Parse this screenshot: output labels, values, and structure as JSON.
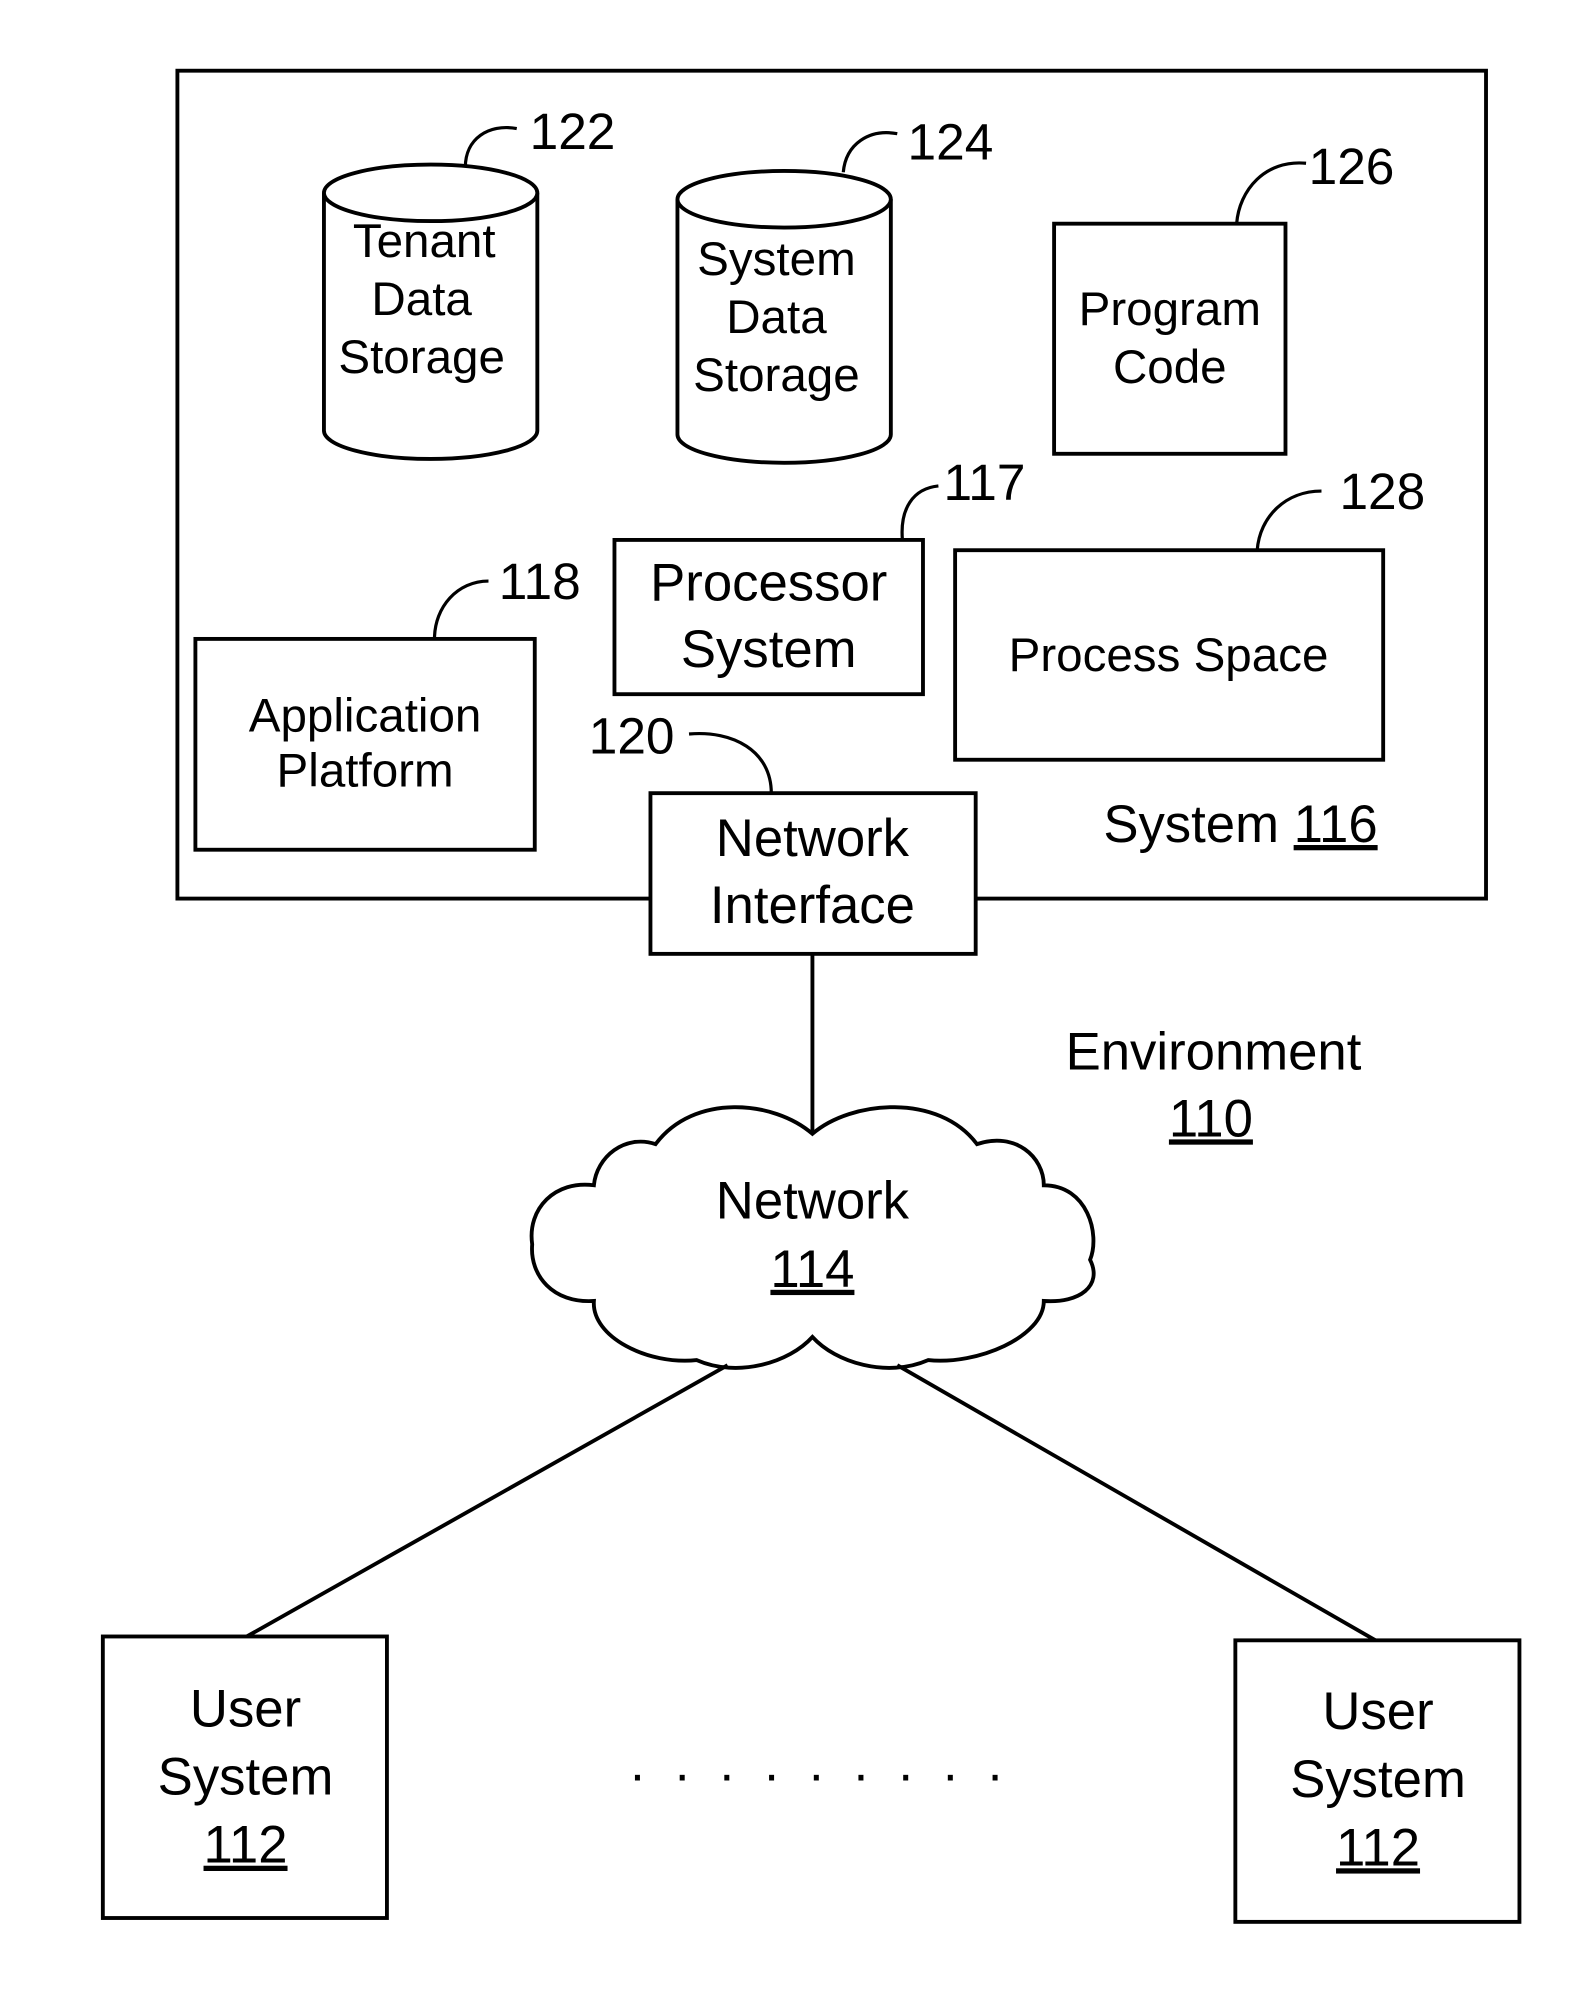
{
  "diagram": {
    "environment": {
      "label": "Environment",
      "ref": "110"
    },
    "system": {
      "label": "System",
      "ref": "116"
    },
    "components": {
      "tenant_data_storage": {
        "lines": [
          "Tenant",
          "Data",
          "Storage"
        ],
        "ref": "122"
      },
      "system_data_storage": {
        "lines": [
          "System",
          "Data",
          "Storage"
        ],
        "ref": "124"
      },
      "program_code": {
        "lines": [
          "Program",
          "Code"
        ],
        "ref": "126"
      },
      "processor_system": {
        "lines": [
          "Processor",
          "System"
        ],
        "ref": "117"
      },
      "process_space": {
        "lines": [
          "Process Space"
        ],
        "ref": "128"
      },
      "application_platform": {
        "lines": [
          "Application",
          "Platform"
        ],
        "ref": "118"
      },
      "network_interface": {
        "lines": [
          "Network",
          "Interface"
        ],
        "ref": "120"
      }
    },
    "network": {
      "label": "Network",
      "ref": "114"
    },
    "user_systems": [
      {
        "lines": [
          "User",
          "System"
        ],
        "ref": "112"
      },
      {
        "lines": [
          "User",
          "System"
        ],
        "ref": "112"
      }
    ],
    "ellipsis": ". . . . . . . . ."
  }
}
